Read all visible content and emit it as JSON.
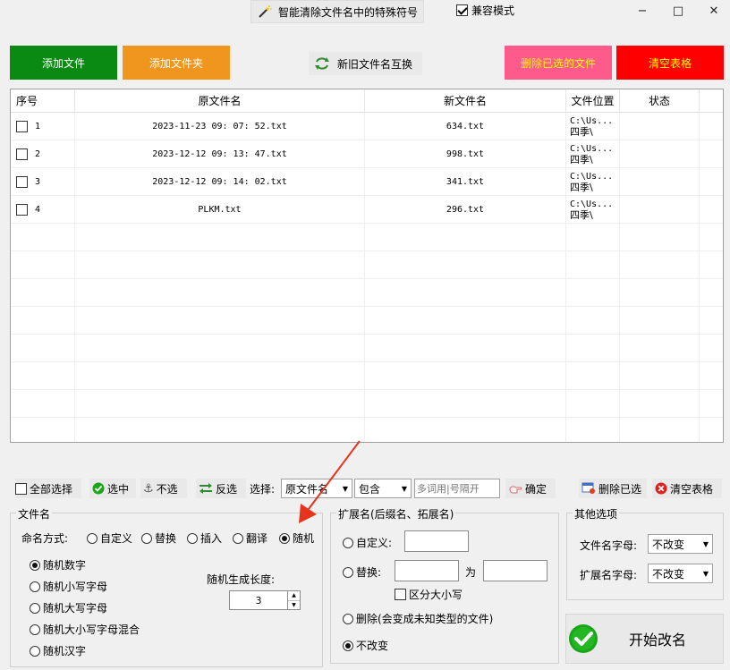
{
  "titlebar": {
    "app_title": "智能清除文件名中的特殊符号",
    "compat_mode_label": "兼容模式",
    "compat_mode_checked": true,
    "minimize": "−",
    "maximize": "□",
    "close": "✕"
  },
  "actions": {
    "add_file": "添加文件",
    "add_folder": "添加文件夹",
    "swap_names": "新旧文件名互换",
    "delete_selected": "删除已选的文件",
    "clear_table": "清空表格"
  },
  "colors": {
    "add_file_bg": "#0a8a12",
    "add_folder_bg": "#f0961e",
    "delete_selected_bg": "#ff5a8c",
    "delete_selected_fg": "#ffff00",
    "clear_table_bg": "#ff0000",
    "clear_table_fg": "#ffff00",
    "arrow": "#e8341c",
    "check_green": "#1aa61a"
  },
  "table": {
    "headers": [
      "序号",
      "原文件名",
      "新文件名",
      "文件位置",
      "状态"
    ],
    "rows": [
      {
        "index": "1",
        "original": "2023-11-23 09: 07: 52.txt",
        "new": "634.txt",
        "loc1": "C:\\Us...",
        "loc2": "四季\\",
        "status": ""
      },
      {
        "index": "2",
        "original": "2023-12-12 09: 13: 47.txt",
        "new": "998.txt",
        "loc1": "C:\\Us...",
        "loc2": "四季\\",
        "status": ""
      },
      {
        "index": "3",
        "original": "2023-12-12 09: 14: 02.txt",
        "new": "341.txt",
        "loc1": "C:\\Us...",
        "loc2": "四季\\",
        "status": ""
      },
      {
        "index": "4",
        "original": "PLKM.txt",
        "new": "296.txt",
        "loc1": "C:\\Us...",
        "loc2": "四季\\",
        "status": ""
      }
    ]
  },
  "toolbar": {
    "select_all": "全部选择",
    "select": "选中",
    "deselect": "不选",
    "invert": "反选",
    "choose_label": "选择:",
    "field_select": "原文件名",
    "match_select": "包含",
    "keyword_placeholder": "多词用|号隔开",
    "confirm": "确定",
    "delete_selected": "删除已选",
    "clear_table": "清空表格"
  },
  "filename_group": {
    "title": "文件名",
    "mode_label": "命名方式:",
    "modes": [
      "自定义",
      "替换",
      "插入",
      "翻译",
      "随机"
    ],
    "selected_mode": "随机",
    "random_options": [
      "随机数字",
      "随机小写字母",
      "随机大写字母",
      "随机大小写字母混合",
      "随机汉字"
    ],
    "selected_random": "随机数字",
    "length_label": "随机生成长度:",
    "length_value": "3"
  },
  "ext_group": {
    "title": "扩展名(后缀名、拓展名)",
    "custom": "自定义:",
    "replace": "替换:",
    "to": "为",
    "case_sensitive": "区分大小写",
    "delete": "删除(会变成未知类型的文件)",
    "unchanged": "不改变"
  },
  "other_group": {
    "title": "其他选项",
    "name_case_label": "文件名字母:",
    "name_case_value": "不改变",
    "ext_case_label": "扩展名字母:",
    "ext_case_value": "不改变"
  },
  "start": {
    "label": "开始改名"
  }
}
